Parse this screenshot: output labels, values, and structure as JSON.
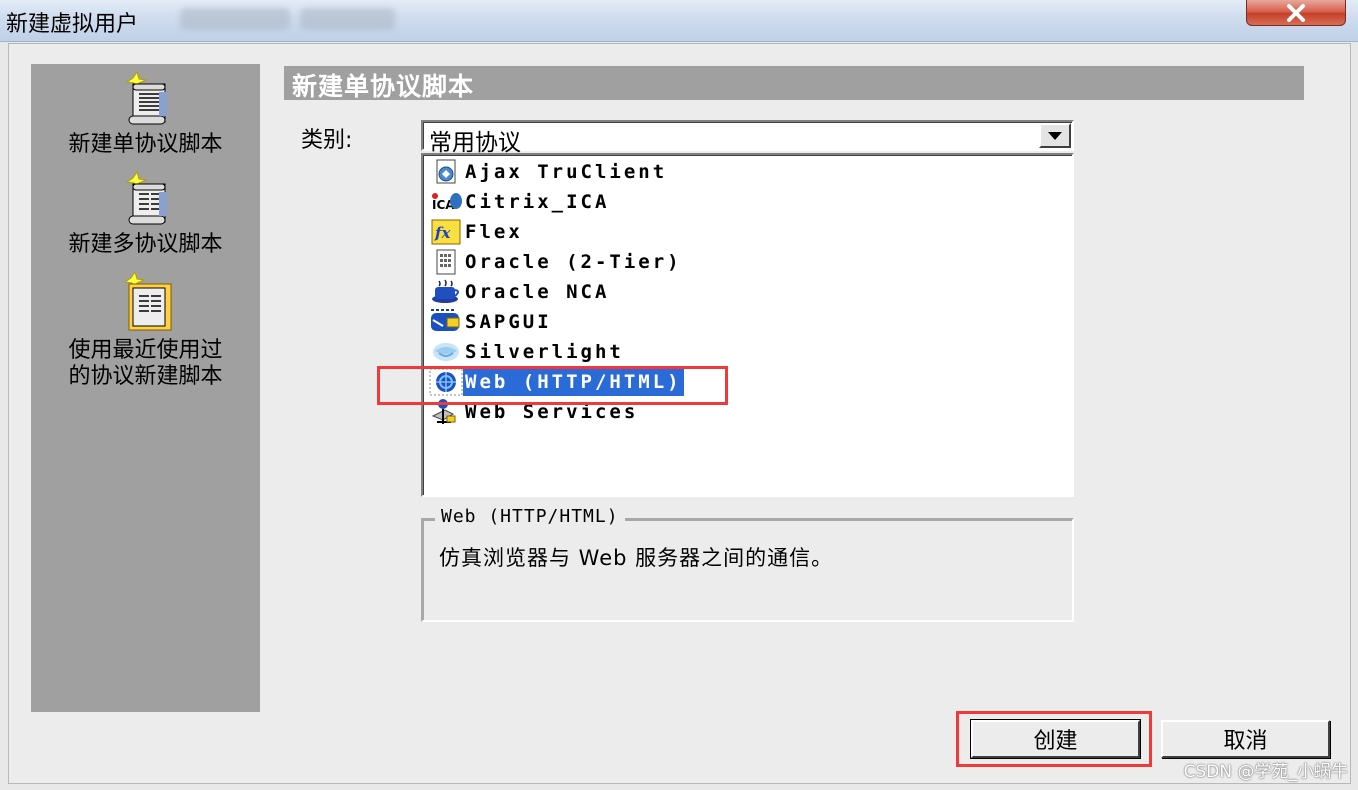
{
  "window": {
    "title": "新建虚拟用户",
    "close_icon": "close-icon"
  },
  "left_panel": {
    "items": [
      {
        "label": "新建单协议脚本",
        "icon": "new-single-script-icon"
      },
      {
        "label": "新建多协议脚本",
        "icon": "new-multi-script-icon"
      },
      {
        "label_line1": "使用最近使用过",
        "label_line2": "的协议新建脚本",
        "icon": "recent-script-icon"
      }
    ]
  },
  "header": {
    "title": "新建单协议脚本"
  },
  "category": {
    "label": "类别:",
    "selected": "常用协议"
  },
  "protocols": [
    {
      "name": "Ajax TruClient",
      "icon": "ajax-truclient-icon",
      "selected": false
    },
    {
      "name": "Citrix_ICA",
      "icon": "citrix-ica-icon",
      "selected": false
    },
    {
      "name": "Flex",
      "icon": "flex-icon",
      "selected": false
    },
    {
      "name": "Oracle (2-Tier)",
      "icon": "oracle-2tier-icon",
      "selected": false
    },
    {
      "name": "Oracle NCA",
      "icon": "oracle-nca-icon",
      "selected": false
    },
    {
      "name": "SAPGUI",
      "icon": "sapgui-icon",
      "selected": false
    },
    {
      "name": "Silverlight",
      "icon": "silverlight-icon",
      "selected": false
    },
    {
      "name": "Web (HTTP/HTML)",
      "icon": "web-http-html-icon",
      "selected": true
    },
    {
      "name": "Web Services",
      "icon": "web-services-icon",
      "selected": false
    }
  ],
  "description": {
    "legend": "Web (HTTP/HTML)",
    "text": "仿真浏览器与 Web 服务器之间的通信。"
  },
  "buttons": {
    "create": "创建",
    "cancel": "取消"
  },
  "watermark": "CSDN @学苑_小蜗牛",
  "colors": {
    "selection": "#2a6bd8",
    "highlight_box": "#f0393b",
    "panel_gray": "#a0a0a0"
  }
}
